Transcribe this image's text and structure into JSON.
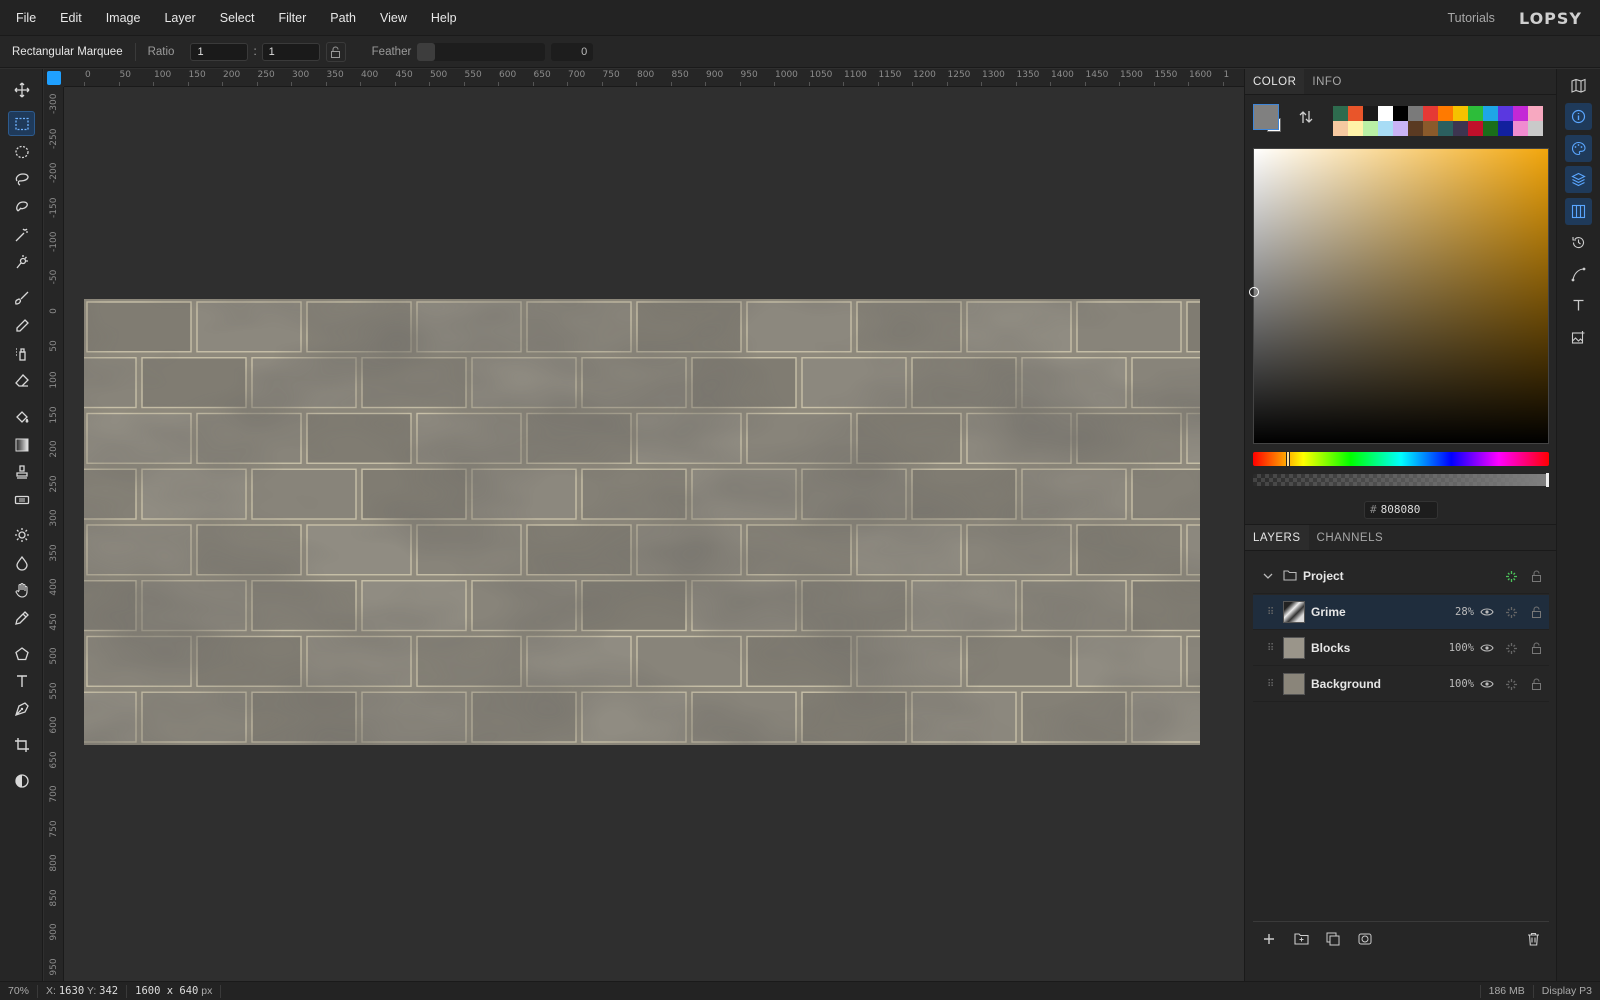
{
  "menu": [
    "File",
    "Edit",
    "Image",
    "Layer",
    "Select",
    "Filter",
    "Path",
    "View",
    "Help"
  ],
  "header": {
    "tutorials": "Tutorials",
    "logo": "LOPSY"
  },
  "options": {
    "tool_name": "Rectangular Marquee",
    "ratio_label": "Ratio",
    "ratio_w": "1",
    "ratio_h": "1",
    "ratio_separator": ":",
    "feather_label": "Feather",
    "feather_value": "0"
  },
  "tools": [
    "move-tool",
    "rect-marquee-tool",
    "ellipse-marquee-tool",
    "lasso-tool",
    "magnetic-lasso-tool",
    "magic-wand-tool",
    "quick-select-tool",
    "brush-tool",
    "pencil-tool",
    "spray-tool",
    "eraser-tool",
    "fill-tool",
    "gradient-tool",
    "stamp-tool",
    "healing-tool",
    "dodge-tool",
    "blur-tool",
    "hand-tool",
    "eyedropper-tool",
    "shape-tool",
    "text-tool",
    "pen-tool",
    "crop-tool",
    "contrast-tool"
  ],
  "rulers": {
    "top": [
      "0",
      "50",
      "100",
      "150",
      "200",
      "250",
      "300",
      "350",
      "400",
      "450",
      "500",
      "550",
      "600",
      "650",
      "700",
      "750",
      "800",
      "850",
      "900",
      "950",
      "1000",
      "1050",
      "1100",
      "1150",
      "1200",
      "1250",
      "1300",
      "1350",
      "1400",
      "1450",
      "1500",
      "1550",
      "1600",
      "1"
    ],
    "left": [
      "-300",
      "-250",
      "-200",
      "-150",
      "-100",
      "-50",
      "0",
      "50",
      "100",
      "150",
      "200",
      "250",
      "300",
      "350",
      "400",
      "450",
      "500",
      "550",
      "600",
      "650",
      "700",
      "750",
      "800",
      "850",
      "900",
      "950"
    ]
  },
  "color_panel": {
    "tabs": [
      "COLOR",
      "INFO"
    ],
    "foreground": "#808080",
    "background": "#ffffff",
    "hex_label": "#",
    "hex": "808080",
    "palette": [
      "#2e6b4e",
      "#e9552a",
      "#1a1a1a",
      "#ffffff",
      "#000000",
      "#7a7a7a",
      "#e53935",
      "#ff7a00",
      "#f5c200",
      "#2dbd3a",
      "#1ea6e6",
      "#5a38e0",
      "#c428d6",
      "#f7a8c0",
      "#f6c9a0",
      "#fff2a8",
      "#b9f0a5",
      "#a8dcf5",
      "#c9b3f5",
      "#5a3a22",
      "#8a5a2b",
      "#2b5f5f",
      "#3d3550",
      "#c0102a",
      "#1a6e1a",
      "#12209e",
      "#f08cd0",
      "#c9c9c9"
    ]
  },
  "layers_panel": {
    "tabs": [
      "LAYERS",
      "CHANNELS"
    ],
    "group": {
      "name": "Project"
    },
    "layers": [
      {
        "name": "Grime",
        "opacity": "28%"
      },
      {
        "name": "Blocks",
        "opacity": "100%"
      },
      {
        "name": "Background",
        "opacity": "100%"
      }
    ]
  },
  "status": {
    "zoom": "70%",
    "x_label": "X:",
    "x": "1630",
    "y_label": "Y:",
    "y": "342",
    "size": "1600 x 640",
    "size_unit": "px",
    "memory": "186 MB",
    "profile": "Display P3"
  }
}
